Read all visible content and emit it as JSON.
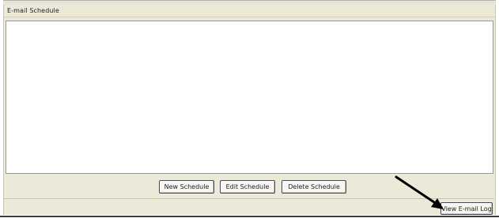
{
  "group": {
    "title": "E-mail Schedule"
  },
  "buttons": {
    "new_schedule": "New Schedule",
    "edit_schedule": "Edit Schedule",
    "delete_schedule": "Delete Schedule"
  },
  "footer": {
    "view_log": "View E-mail Log"
  },
  "annotation": {
    "icon": "arrow-icon",
    "color": "#000000"
  }
}
